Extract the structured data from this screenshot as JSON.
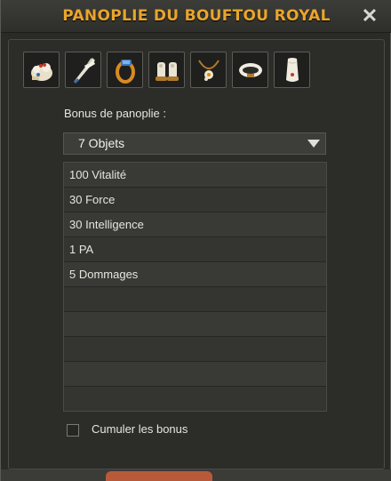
{
  "window": {
    "title": "PANOPLIE DU BOUFTOU ROYAL",
    "close_glyph": "✕"
  },
  "items": [
    {
      "icon": "bouftou-hat-icon"
    },
    {
      "icon": "hammer-weapon-icon"
    },
    {
      "icon": "ring-icon"
    },
    {
      "icon": "boots-icon"
    },
    {
      "icon": "amulet-icon"
    },
    {
      "icon": "belt-icon"
    },
    {
      "icon": "cape-icon"
    }
  ],
  "bonus": {
    "label": "Bonus de panoplie :",
    "selected_option": "7 Objets",
    "lines": [
      "100 Vitalité",
      "30 Force",
      "30 Intelligence",
      "1 PA",
      "5 Dommages",
      "",
      "",
      "",
      "",
      ""
    ]
  },
  "cumulate": {
    "label": "Cumuler les bonus",
    "checked": false
  },
  "colors": {
    "title": "#e9a52c",
    "background": "#2a2a27"
  }
}
